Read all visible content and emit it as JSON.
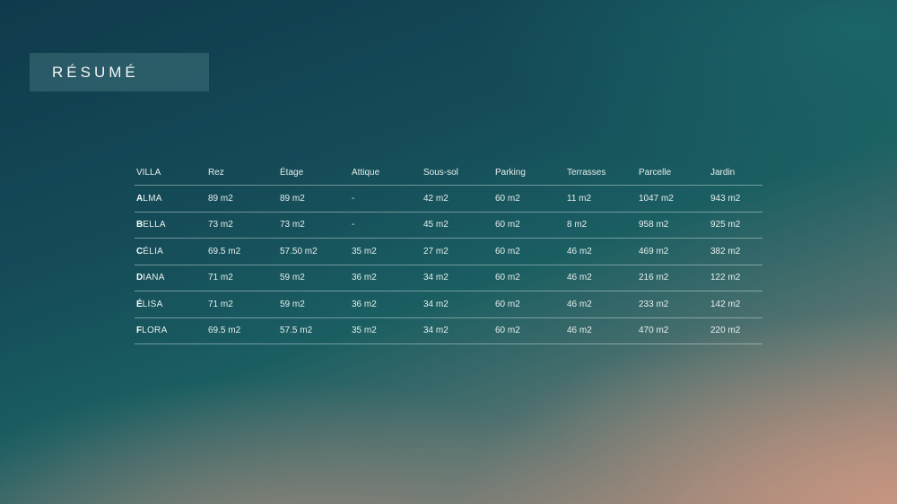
{
  "title": "RÉSUMÉ",
  "table": {
    "headers": [
      "VILLA",
      "Rez",
      "Étage",
      "Attique",
      "Sous-sol",
      "Parking",
      "Terrasses",
      "Parcelle",
      "Jardin"
    ],
    "rows": [
      {
        "initial": "A",
        "rest": "LMA",
        "cells": [
          "89 m2",
          "89 m2",
          "-",
          "42 m2",
          "60 m2",
          "11 m2",
          "1047 m2",
          "943 m2"
        ]
      },
      {
        "initial": "B",
        "rest": "ELLA",
        "cells": [
          "73 m2",
          "73 m2",
          "-",
          "45 m2",
          "60 m2",
          "8 m2",
          "958 m2",
          "925 m2"
        ]
      },
      {
        "initial": "C",
        "rest": "ÉLIA",
        "cells": [
          "69.5 m2",
          "57.50 m2",
          "35 m2",
          "27 m2",
          "60 m2",
          "46 m2",
          "469 m2",
          "382 m2"
        ]
      },
      {
        "initial": "D",
        "rest": "IANA",
        "cells": [
          "71 m2",
          "59 m2",
          "36 m2",
          "34 m2",
          "60 m2",
          "46 m2",
          "216 m2",
          "122 m2"
        ]
      },
      {
        "initial": "É",
        "rest": "LISA",
        "cells": [
          "71 m2",
          "59 m2",
          "36 m2",
          "34 m2",
          "60 m2",
          "46 m2",
          "233 m2",
          "142 m2"
        ]
      },
      {
        "initial": "F",
        "rest": "LORA",
        "cells": [
          "69.5 m2",
          "57.5 m2",
          "35 m2",
          "34 m2",
          "60 m2",
          "46 m2",
          "470 m2",
          "220 m2"
        ]
      }
    ]
  }
}
